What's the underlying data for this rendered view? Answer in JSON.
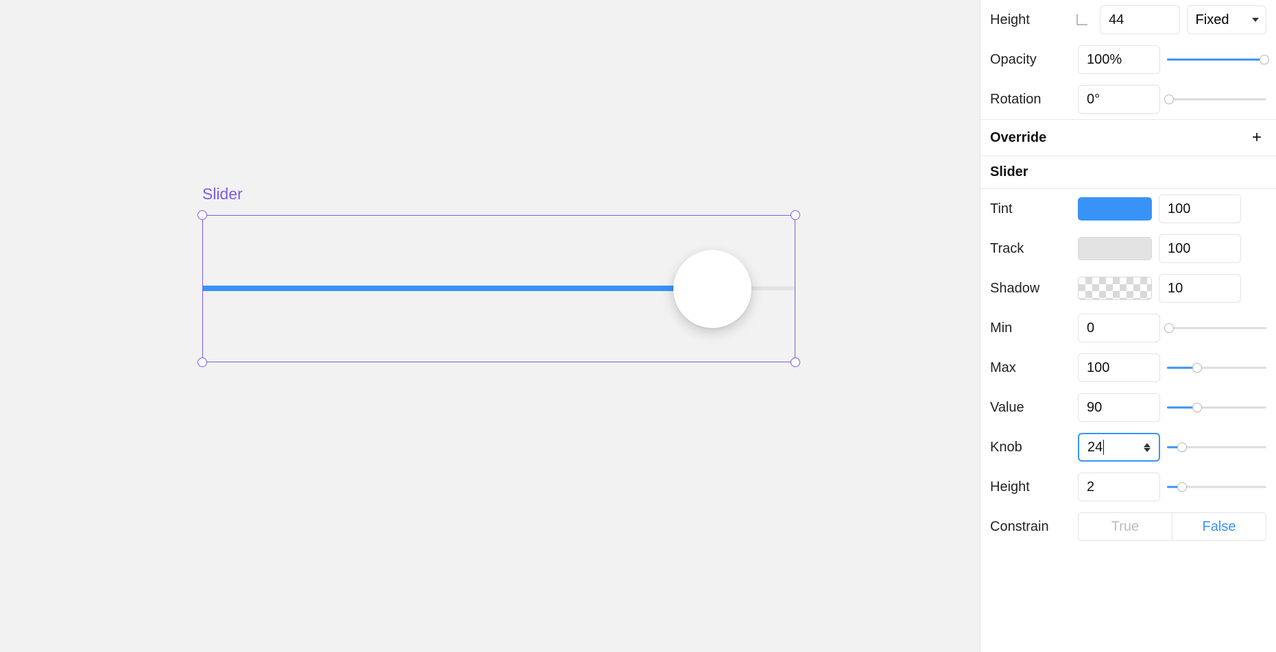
{
  "canvas": {
    "element_label": "Slider"
  },
  "geometry": {
    "height": {
      "label": "Height",
      "value": "44",
      "mode": "Fixed"
    },
    "opacity": {
      "label": "Opacity",
      "value": "100%",
      "slider_pct": 98
    },
    "rotation": {
      "label": "Rotation",
      "value": "0°",
      "slider_pct": 2
    }
  },
  "override": {
    "title": "Override"
  },
  "slider_section": {
    "title": "Slider",
    "tint": {
      "label": "Tint",
      "value": "100",
      "swatch": "blue"
    },
    "track": {
      "label": "Track",
      "value": "100",
      "swatch": "grey"
    },
    "shadow": {
      "label": "Shadow",
      "value": "10",
      "swatch": "checker"
    },
    "min": {
      "label": "Min",
      "value": "0",
      "slider_pct": 2
    },
    "max": {
      "label": "Max",
      "value": "100",
      "slider_pct": 30
    },
    "value": {
      "label": "Value",
      "value": "90",
      "slider_pct": 30
    },
    "knob": {
      "label": "Knob",
      "value": "24",
      "slider_pct": 15
    },
    "height": {
      "label": "Height",
      "value": "2",
      "slider_pct": 15
    },
    "constrain": {
      "label": "Constrain",
      "true": "True",
      "false": "False"
    }
  }
}
